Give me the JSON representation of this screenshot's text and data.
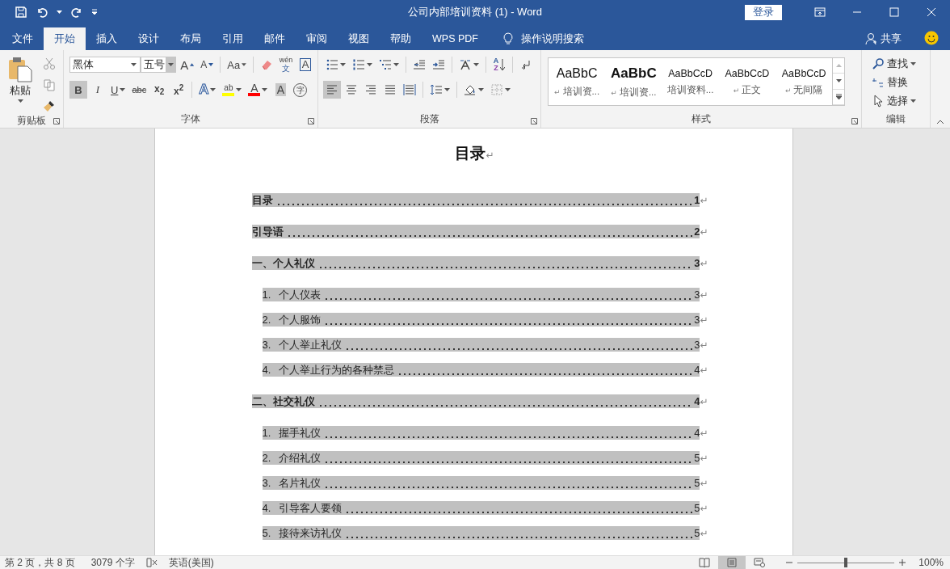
{
  "window": {
    "title": "公司内部培训资料 (1)  -  Word",
    "signin": "登录"
  },
  "tabs": [
    {
      "label": "文件",
      "selected": false
    },
    {
      "label": "开始",
      "selected": true
    },
    {
      "label": "插入",
      "selected": false
    },
    {
      "label": "设计",
      "selected": false
    },
    {
      "label": "布局",
      "selected": false
    },
    {
      "label": "引用",
      "selected": false
    },
    {
      "label": "邮件",
      "selected": false
    },
    {
      "label": "审阅",
      "selected": false
    },
    {
      "label": "视图",
      "selected": false
    },
    {
      "label": "帮助",
      "selected": false
    },
    {
      "label": "WPS PDF",
      "selected": false
    }
  ],
  "tell_me": "操作说明搜索",
  "share": "共享",
  "clipboard": {
    "paste": "粘贴",
    "label": "剪贴板"
  },
  "font": {
    "label": "字体",
    "name": "黑体",
    "size": "五号",
    "row1": [
      {
        "kind": "grow",
        "label": "A"
      },
      {
        "kind": "shrink",
        "label": "A"
      },
      {
        "kind": "case",
        "label": "Aa"
      },
      {
        "kind": "eraser"
      },
      {
        "kind": "phonetic",
        "label": "wén",
        "sub": "文"
      },
      {
        "kind": "boxed",
        "label": "A"
      }
    ],
    "row2": [
      {
        "kind": "bold",
        "label": "B",
        "selected": true
      },
      {
        "kind": "italic",
        "label": "I",
        "selected": false
      },
      {
        "kind": "underline",
        "label": "U",
        "selected": false
      },
      {
        "kind": "strike",
        "label": "abc",
        "selected": false
      },
      {
        "kind": "script",
        "label": "x$_{2}$",
        "selected": false
      },
      {
        "kind": "script",
        "label": "x$^{2}$",
        "selected": false
      },
      {
        "kind": "effects",
        "label": "A"
      },
      {
        "kind": "highlight",
        "label": "ab",
        "color": "#ffff00"
      },
      {
        "kind": "fontcolor",
        "label": "A",
        "color": "#ff0000"
      },
      {
        "kind": "shade",
        "label": "A"
      },
      {
        "kind": "enclose",
        "label": "字"
      }
    ]
  },
  "paragraph": {
    "label": "段落",
    "sort": [
      "A",
      "Z"
    ],
    "align": [
      {
        "kind": "left",
        "selected": true
      },
      {
        "kind": "center",
        "selected": false
      },
      {
        "kind": "right",
        "selected": false
      },
      {
        "kind": "justify",
        "selected": false
      },
      {
        "kind": "distribute",
        "selected": false
      }
    ]
  },
  "styles": {
    "label": "样式",
    "items": [
      {
        "kind": "title",
        "sample": "AaBbC",
        "name": "培训资...",
        "mark": "↵"
      },
      {
        "kind": "bold",
        "sample": "AaBbC",
        "name": "培训资...",
        "mark": "↵"
      },
      {
        "kind": "small",
        "sample": "AaBbCcD",
        "name": "培训资料..."
      },
      {
        "kind": "small",
        "sample": "AaBbCcD",
        "name": "正文",
        "mark": "↵"
      },
      {
        "kind": "small",
        "sample": "AaBbCcD",
        "name": "无间隔",
        "mark": "↵"
      }
    ]
  },
  "editing": {
    "label": "编辑",
    "find": "查找",
    "replace": "替换",
    "select": "选择"
  },
  "document": {
    "title": "目录",
    "title_mark": "↵",
    "toc": [
      {
        "text": "目录",
        "page": "1",
        "mark": "↵"
      },
      {
        "text": "引导语",
        "page": "2",
        "mark": "↵"
      },
      {
        "text": "一、个人礼仪",
        "page": "3",
        "mark": "↵",
        "children": [
          {
            "number": "1.",
            "text": "个人仪表",
            "page": "3",
            "mark": "↵"
          },
          {
            "number": "2.",
            "text": "个人服饰",
            "page": "3",
            "mark": "↵"
          },
          {
            "number": "3.",
            "text": "个人举止礼仪",
            "page": "3",
            "mark": "↵"
          },
          {
            "number": "4.",
            "text": "个人举止行为的各种禁忌",
            "page": "4",
            "mark": "↵"
          }
        ]
      },
      {
        "text": "二、社交礼仪",
        "page": "4",
        "mark": "↵",
        "children": [
          {
            "number": "1.",
            "text": "握手礼仪",
            "page": "4",
            "mark": "↵"
          },
          {
            "number": "2.",
            "text": "介绍礼仪",
            "page": "5",
            "mark": "↵"
          },
          {
            "number": "3.",
            "text": "名片礼仪",
            "page": "5",
            "mark": "↵"
          },
          {
            "number": "4.",
            "text": "引导客人要领",
            "page": "5",
            "mark": "↵"
          },
          {
            "number": "5.",
            "text": "接待来访礼仪",
            "page": "5",
            "mark": "↵"
          }
        ]
      }
    ]
  },
  "status_bar": {
    "page": "第 2 页，共 8 页",
    "words": "3079 个字",
    "language": "英语(美国)",
    "views": [
      {
        "kind": "read",
        "selected": false
      },
      {
        "kind": "print",
        "selected": true
      },
      {
        "kind": "web",
        "selected": false
      }
    ],
    "zoom": {
      "level": 0.5,
      "reading": "100%"
    }
  }
}
